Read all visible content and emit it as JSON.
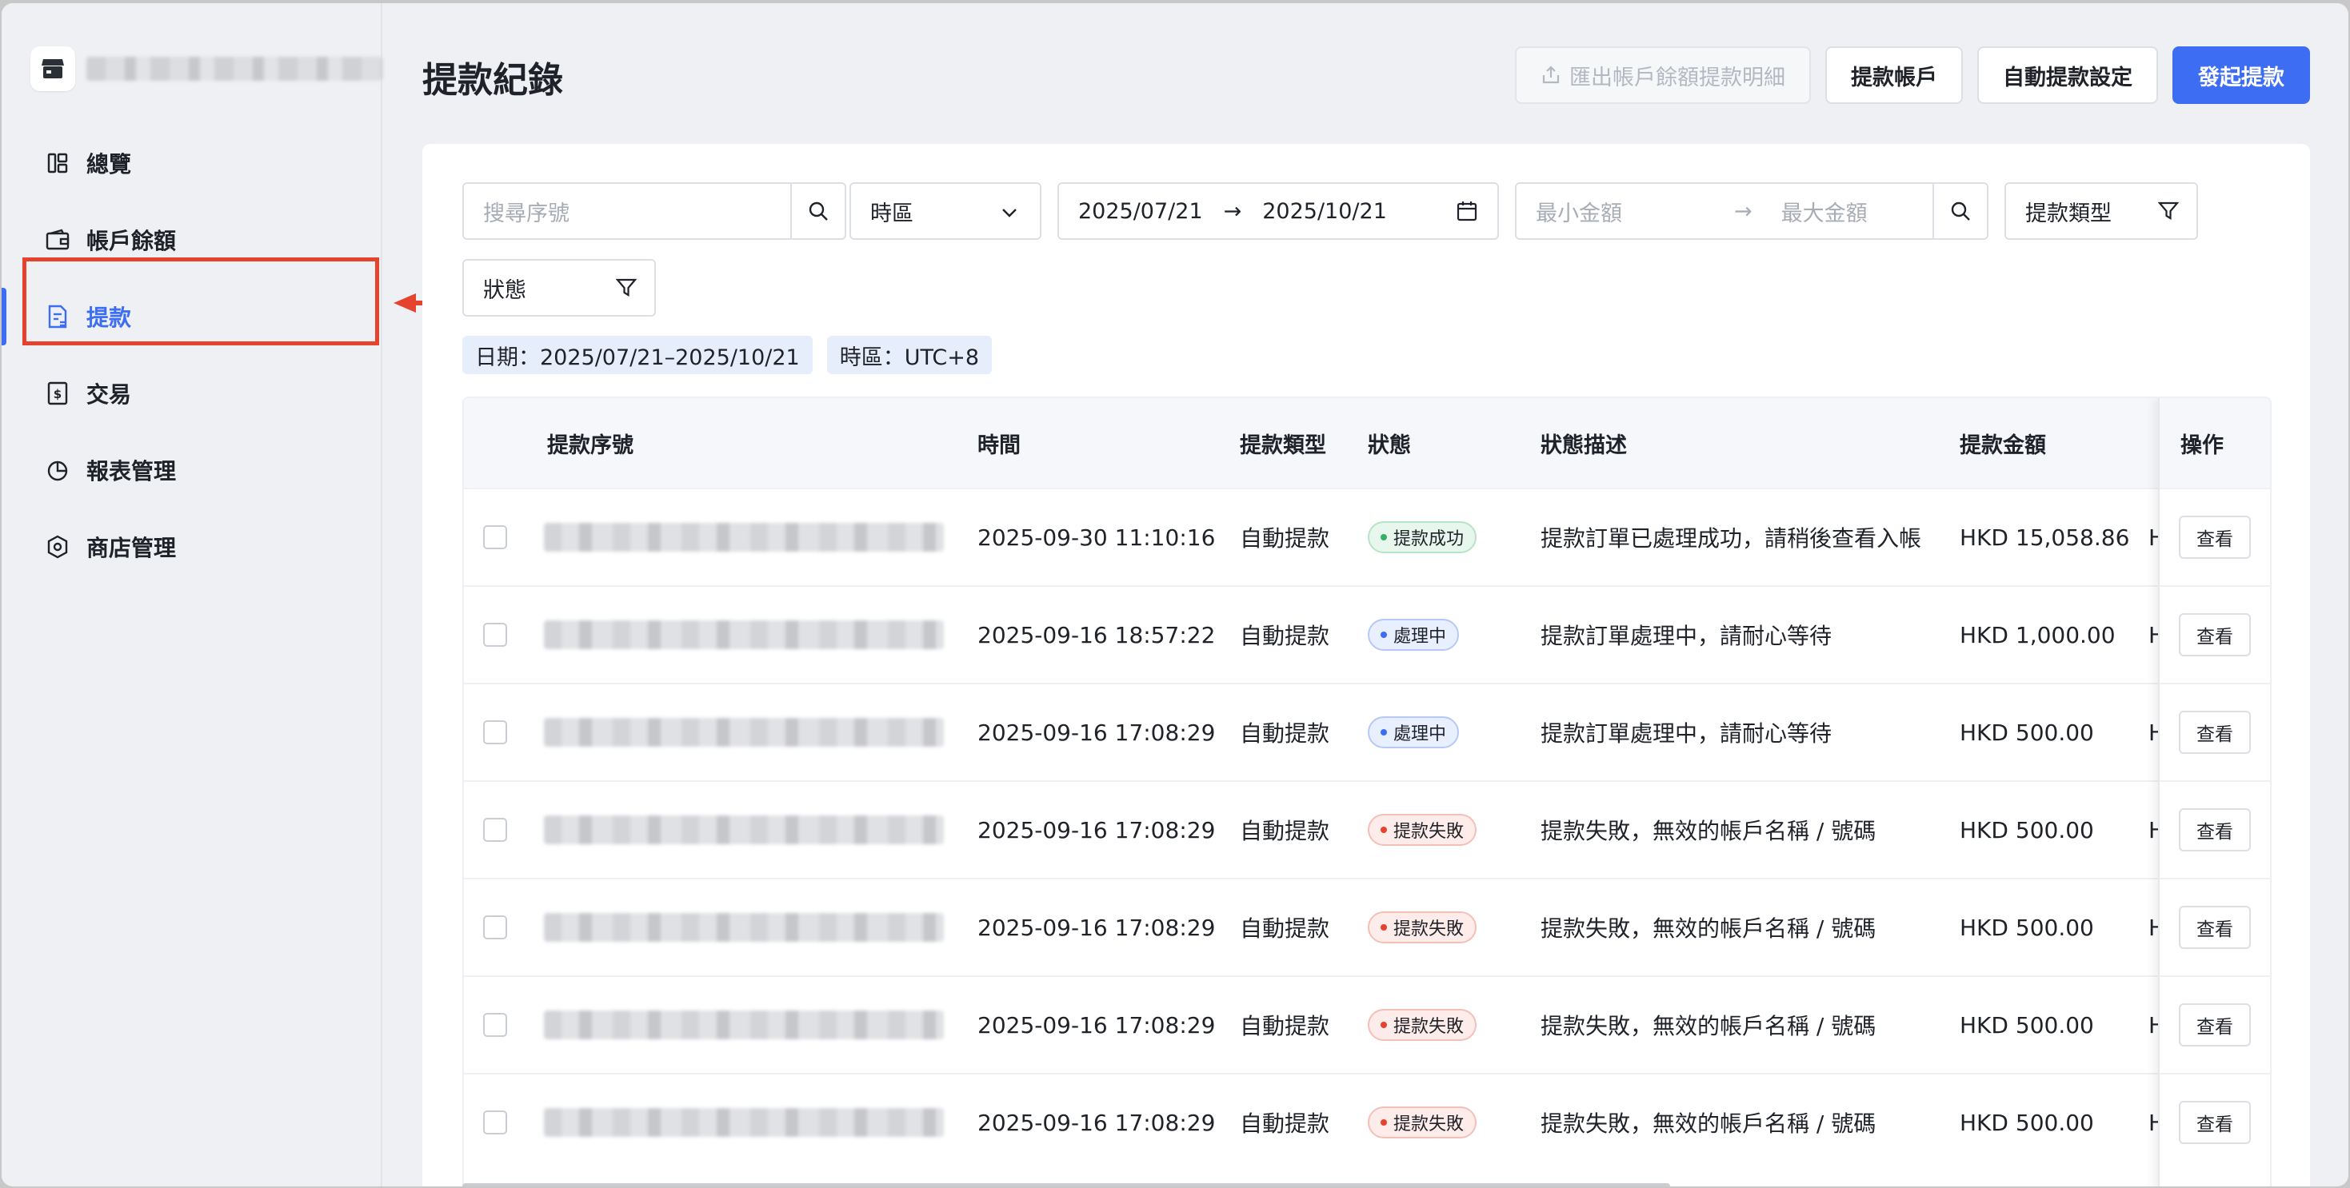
{
  "sidebar": {
    "store_name": "",
    "items": [
      {
        "label": "總覽",
        "icon": "dashboard-icon"
      },
      {
        "label": "帳戶餘額",
        "icon": "wallet-icon"
      },
      {
        "label": "提款",
        "icon": "withdraw-icon",
        "active": true
      },
      {
        "label": "交易",
        "icon": "transaction-icon"
      },
      {
        "label": "報表管理",
        "icon": "report-icon"
      },
      {
        "label": "商店管理",
        "icon": "store-settings-icon"
      }
    ]
  },
  "header": {
    "title": "提款紀錄",
    "export_label": "匯出帳戶餘額提款明細",
    "account_label": "提款帳戶",
    "auto_settings_label": "自動提款設定",
    "initiate_label": "發起提款"
  },
  "filters": {
    "search_placeholder": "搜尋序號",
    "timezone_label": "時區",
    "date_from": "2025/07/21",
    "date_to": "2025/10/21",
    "min_amount_placeholder": "最小金額",
    "max_amount_placeholder": "最大金額",
    "type_label": "提款類型",
    "status_label": "狀態"
  },
  "tags": {
    "date": "日期：2025/07/21–2025/10/21",
    "timezone": "時區：UTC+8"
  },
  "table": {
    "columns": {
      "id": "提款序號",
      "time": "時間",
      "type": "提款類型",
      "status": "狀態",
      "description": "狀態描述",
      "amount": "提款金額",
      "operation": "操作"
    },
    "view_label": "查看",
    "rows": [
      {
        "time": "2025-09-30 11:10:16",
        "type": "自動提款",
        "status": "提款成功",
        "status_kind": "success",
        "description": "提款訂單已處理成功，請稍後查看入帳",
        "amount": "HKD 15,058.86",
        "overflow": "H"
      },
      {
        "time": "2025-09-16 18:57:22",
        "type": "自動提款",
        "status": "處理中",
        "status_kind": "processing",
        "description": "提款訂單處理中，請耐心等待",
        "amount": "HKD 1,000.00",
        "overflow": "H"
      },
      {
        "time": "2025-09-16 17:08:29",
        "type": "自動提款",
        "status": "處理中",
        "status_kind": "processing",
        "description": "提款訂單處理中，請耐心等待",
        "amount": "HKD 500.00",
        "overflow": "H"
      },
      {
        "time": "2025-09-16 17:08:29",
        "type": "自動提款",
        "status": "提款失敗",
        "status_kind": "failed",
        "description": "提款失敗，無效的帳戶名稱 / 號碼",
        "amount": "HKD 500.00",
        "overflow": "H"
      },
      {
        "time": "2025-09-16 17:08:29",
        "type": "自動提款",
        "status": "提款失敗",
        "status_kind": "failed",
        "description": "提款失敗，無效的帳戶名稱 / 號碼",
        "amount": "HKD 500.00",
        "overflow": "H"
      },
      {
        "time": "2025-09-16 17:08:29",
        "type": "自動提款",
        "status": "提款失敗",
        "status_kind": "failed",
        "description": "提款失敗，無效的帳戶名稱 / 號碼",
        "amount": "HKD 500.00",
        "overflow": "H"
      },
      {
        "time": "2025-09-16 17:08:29",
        "type": "自動提款",
        "status": "提款失敗",
        "status_kind": "failed",
        "description": "提款失敗，無效的帳戶名稱 / 號碼",
        "amount": "HKD 500.00",
        "overflow": "H"
      }
    ]
  },
  "colors": {
    "accent": "#3d6df2",
    "highlight": "#e5432d",
    "success": "#33b266",
    "failed": "#e5432d"
  }
}
